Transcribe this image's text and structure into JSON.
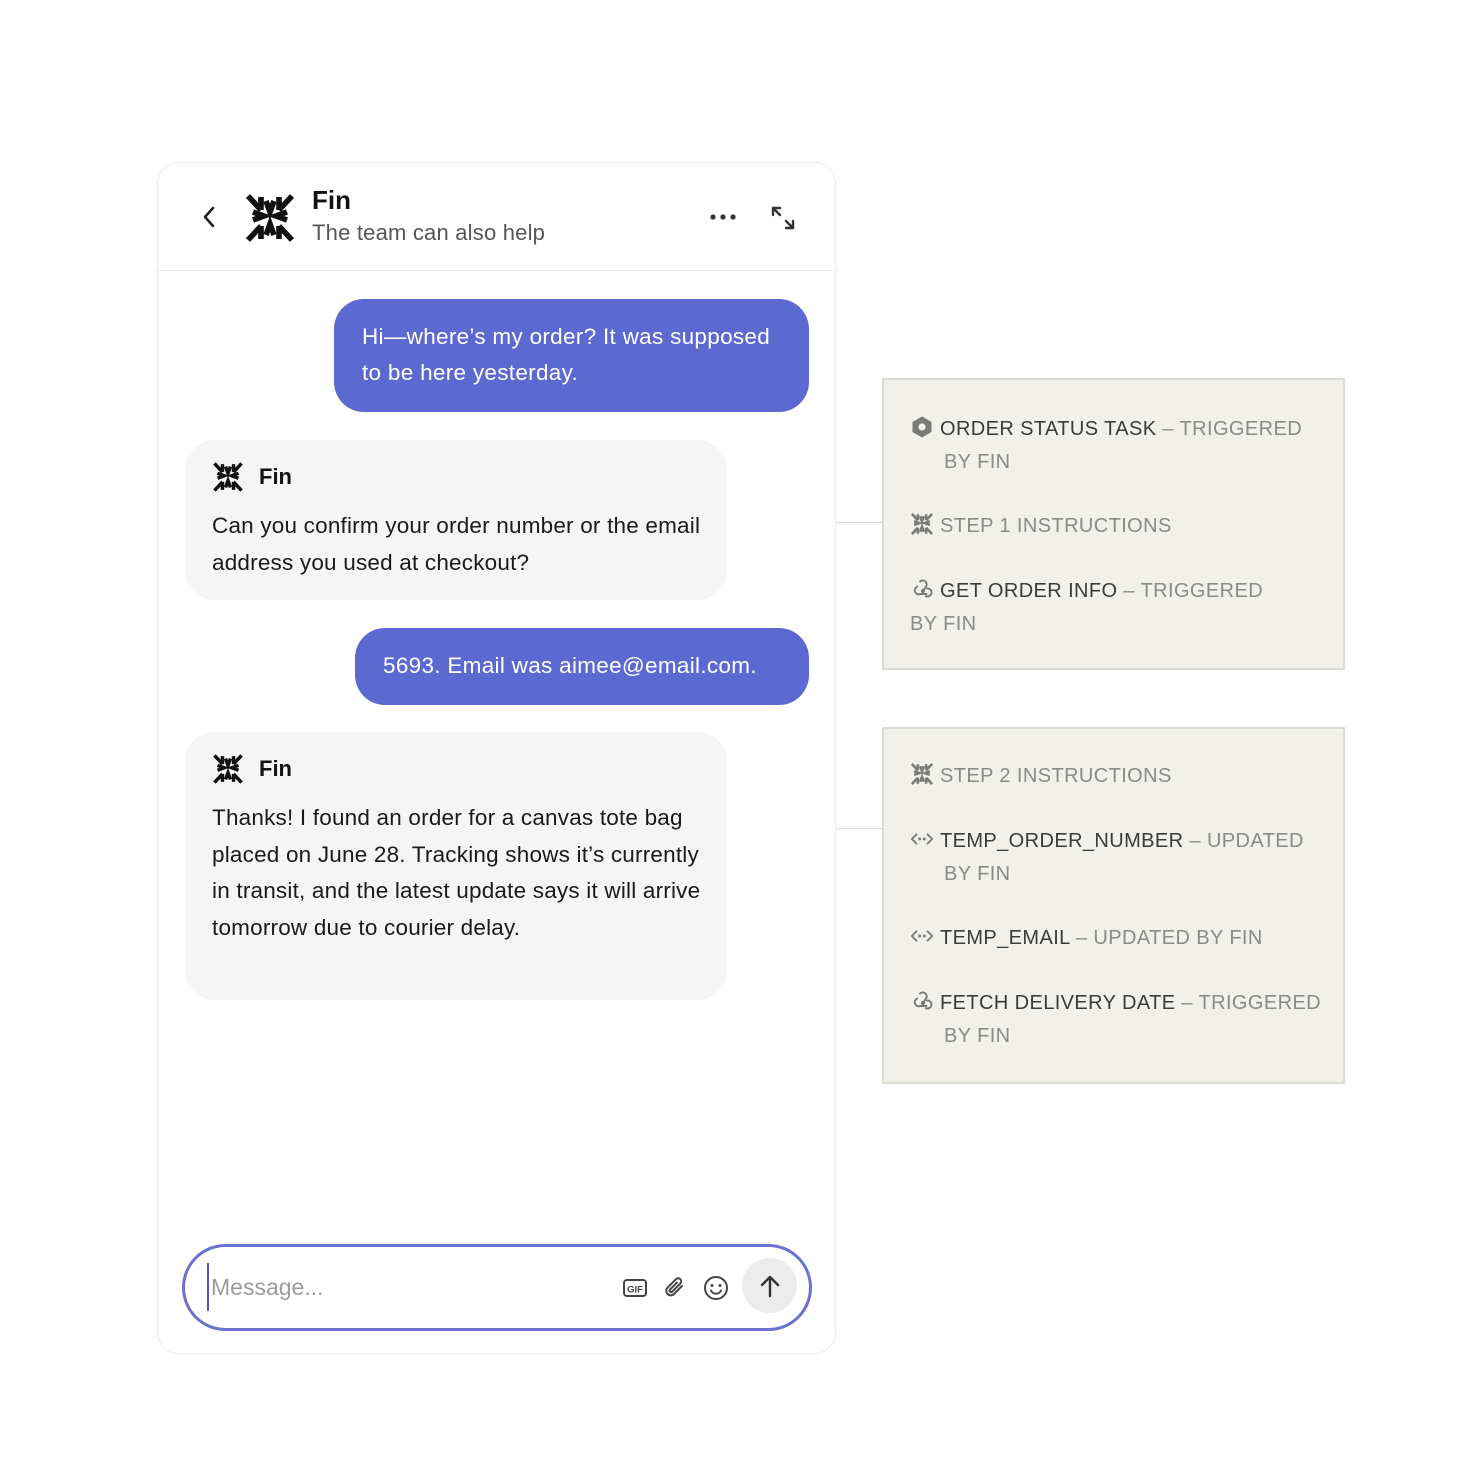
{
  "header": {
    "title": "Fin",
    "subtitle": "The team can also help"
  },
  "messages": {
    "user_1": "Hi—where’s my order? It was supposed to be here yesterday.",
    "bot_1": {
      "name": "Fin",
      "text": "Can you confirm your order number or the email address you used at checkout?"
    },
    "user_2": "5693. Email was aimee@email.com.",
    "bot_2": {
      "name": "Fin",
      "text": "Thanks! I found an order for a canvas tote bag placed on June 28. Tracking shows it’s currently in transit, and the latest update says it will arrive tomorrow due to courier delay."
    }
  },
  "composer": {
    "placeholder": "Message..."
  },
  "panel_1": {
    "items": [
      {
        "icon": "hexagon-task-icon",
        "name": "ORDER STATUS TASK",
        "sep": " – ",
        "status": "TRIGGERED BY FIN"
      },
      {
        "icon": "fin-logo-icon",
        "name": "STEP 1 INSTRUCTIONS"
      },
      {
        "icon": "webhook-icon",
        "name": "GET ORDER INFO",
        "sep": " – ",
        "status": "TRIGGERED BY FIN"
      }
    ]
  },
  "panel_2": {
    "items": [
      {
        "icon": "fin-logo-icon",
        "name": "STEP 2 INSTRUCTIONS"
      },
      {
        "icon": "code-variable-icon",
        "name": "TEMP_ORDER_NUMBER",
        "sep": " – ",
        "status": "UPDATED BY FIN"
      },
      {
        "icon": "code-variable-icon",
        "name": "TEMP_EMAIL",
        "sep": " – ",
        "status": "UPDATED BY FIN"
      },
      {
        "icon": "webhook-icon",
        "name": "FETCH DELIVERY DATE",
        "sep": " – ",
        "status": "TRIGGERED BY FIN"
      }
    ]
  },
  "colors": {
    "accent": "#5c69d1",
    "bot_bubble": "#f5f5f5",
    "panel_bg": "#f1f0eb",
    "panel_border": "#dcdcd7"
  }
}
